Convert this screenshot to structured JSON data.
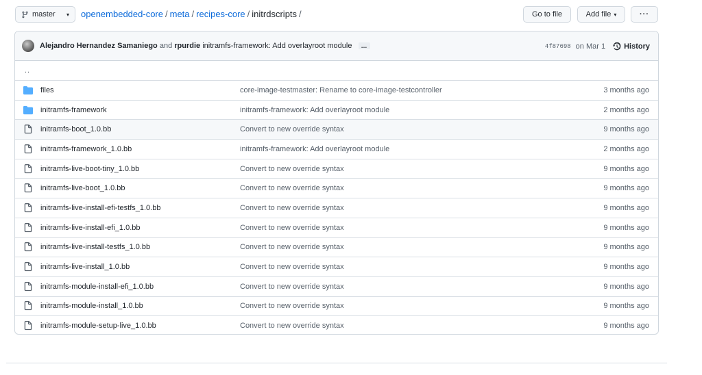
{
  "branch": {
    "label": "master"
  },
  "breadcrumb": {
    "repo": "openembedded-core",
    "path1": "meta",
    "path2": "recipes-core",
    "current": "initrdscripts",
    "sep": "/"
  },
  "actions": {
    "goto_file": "Go to file",
    "add_file": "Add file",
    "more": "···"
  },
  "commit": {
    "author1": "Alejandro Hernandez Samaniego",
    "and": "and",
    "author2": "rpurdie",
    "message": "initramfs-framework: Add overlayroot module",
    "expand": "…",
    "sha": "4f87698",
    "date": "on Mar 1",
    "history": "History"
  },
  "updir": "..",
  "files": [
    {
      "name": "files",
      "type": "dir",
      "message": "core-image-testmaster: Rename to core-image-testcontroller",
      "age": "3 months ago"
    },
    {
      "name": "initramfs-framework",
      "type": "dir",
      "message": "initramfs-framework: Add overlayroot module",
      "age": "2 months ago"
    },
    {
      "name": "initramfs-boot_1.0.bb",
      "type": "file",
      "message": "Convert to new override syntax",
      "age": "9 months ago"
    },
    {
      "name": "initramfs-framework_1.0.bb",
      "type": "file",
      "message": "initramfs-framework: Add overlayroot module",
      "age": "2 months ago"
    },
    {
      "name": "initramfs-live-boot-tiny_1.0.bb",
      "type": "file",
      "message": "Convert to new override syntax",
      "age": "9 months ago"
    },
    {
      "name": "initramfs-live-boot_1.0.bb",
      "type": "file",
      "message": "Convert to new override syntax",
      "age": "9 months ago"
    },
    {
      "name": "initramfs-live-install-efi-testfs_1.0.bb",
      "type": "file",
      "message": "Convert to new override syntax",
      "age": "9 months ago"
    },
    {
      "name": "initramfs-live-install-efi_1.0.bb",
      "type": "file",
      "message": "Convert to new override syntax",
      "age": "9 months ago"
    },
    {
      "name": "initramfs-live-install-testfs_1.0.bb",
      "type": "file",
      "message": "Convert to new override syntax",
      "age": "9 months ago"
    },
    {
      "name": "initramfs-live-install_1.0.bb",
      "type": "file",
      "message": "Convert to new override syntax",
      "age": "9 months ago"
    },
    {
      "name": "initramfs-module-install-efi_1.0.bb",
      "type": "file",
      "message": "Convert to new override syntax",
      "age": "9 months ago"
    },
    {
      "name": "initramfs-module-install_1.0.bb",
      "type": "file",
      "message": "Convert to new override syntax",
      "age": "9 months ago"
    },
    {
      "name": "initramfs-module-setup-live_1.0.bb",
      "type": "file",
      "message": "Convert to new override syntax",
      "age": "9 months ago"
    }
  ],
  "colors": {
    "link": "#0969da",
    "folder": "#54aeff",
    "muted": "#57606a",
    "border": "#d0d7de"
  },
  "icons": {
    "branch": "git-branch-icon",
    "folder": "folder-icon",
    "file": "file-icon",
    "history": "history-icon"
  }
}
